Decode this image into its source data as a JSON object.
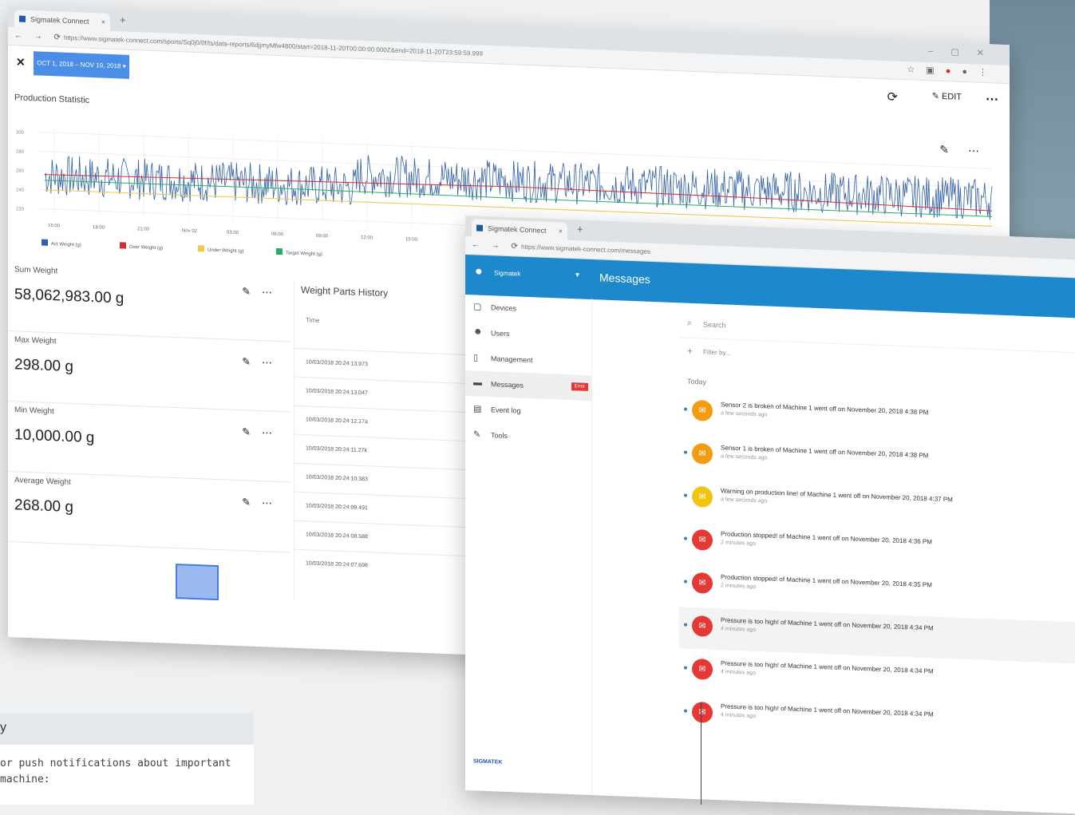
{
  "window1": {
    "tab_title": "Sigmatek Connect",
    "url": "https://www.sigmatek-connect.com/sports/Sq0j0/0f/ts/data-reports/6djjmyMfw4800/start=2018-11-20T00:00:00.000Z&end=2018-11-20T23:59:59.999",
    "date_range": "OCT 1, 2018 – NOV 19, 2018 ▾",
    "edit_label": "EDIT",
    "section_title": "Production Statistic",
    "stats": [
      {
        "label": "Sum Weight",
        "value": "58,062,983.00 g"
      },
      {
        "label": "Max Weight",
        "value": "298.00 g"
      },
      {
        "label": "Min Weight",
        "value": "10,000.00 g"
      },
      {
        "label": "Average Weight",
        "value": "268.00 g"
      }
    ],
    "history": {
      "title": "Weight Parts History",
      "header": "Time",
      "rows": [
        "10/03/2018 20:24:13.973",
        "10/03/2018 20:24:13.047",
        "10/03/2018 20:24:12.17a",
        "10/03/2018 20:24:11.27k",
        "10/03/2018 20:24:10.383",
        "10/03/2018 20:24:09.491",
        "10/03/2018 20:24:08.588",
        "10/03/2018 20:24:07.698"
      ]
    }
  },
  "chart_data": {
    "type": "line",
    "title": "",
    "x_ticks": [
      "15:00",
      "18:00",
      "21:00",
      "Nov 02",
      "03:00",
      "06:00",
      "09:00",
      "12:00",
      "15:00"
    ],
    "y_ticks": [
      "300",
      "280",
      "260",
      "240",
      "220"
    ],
    "ylim": [
      215,
      305
    ],
    "legend_position": "bottom-left",
    "series": [
      {
        "name": "Act Weight (g)",
        "color": "#2f5fa6",
        "style": "noisy",
        "mean_first_half": 255,
        "mean_second_half": 268,
        "amplitude": 22
      },
      {
        "name": "Over Weight (g)",
        "color": "#d32f2f",
        "style": "flat",
        "values": [
          256,
          259,
          262,
          260,
          256
        ]
      },
      {
        "name": "Under Weight (g)",
        "color": "#f2c94c",
        "style": "flat",
        "values": [
          240,
          240,
          240,
          240,
          240
        ]
      },
      {
        "name": "Target Weight (g)",
        "color": "#27ae60",
        "style": "flat",
        "values": [
          250,
          251,
          250,
          250,
          250
        ]
      }
    ]
  },
  "window2": {
    "tab_title": "Sigmatek Connect",
    "url": "https://www.sigmatek-connect.com/messages",
    "user_name": "Sigmatek",
    "page_title": "Messages",
    "sidebar": [
      {
        "label": "Devices",
        "icon": "▢"
      },
      {
        "label": "Users",
        "icon": "☻"
      },
      {
        "label": "Management",
        "icon": "▯"
      },
      {
        "label": "Messages",
        "icon": "▬",
        "badge": "Error",
        "active": true
      },
      {
        "label": "Event log",
        "icon": "▤"
      },
      {
        "label": "Tools",
        "icon": "✎"
      }
    ],
    "brand": "SIGMATEK",
    "search_placeholder": "Search",
    "filter_label": "Filter by...",
    "day_label": "Today",
    "messages": [
      {
        "text": "Sensor 2 is broken of Machine 1 went off on November 20, 2018 4:38 PM",
        "time": "a few seconds ago",
        "color": "#f39c12"
      },
      {
        "text": "Sensor 1 is broken of Machine 1 went off on November 20, 2018 4:38 PM",
        "time": "a few seconds ago",
        "color": "#f39c12"
      },
      {
        "text": "Warning on production line! of Machine 1 went off on November 20, 2018 4:37 PM",
        "time": "a few seconds ago",
        "color": "#f1c40f"
      },
      {
        "text": "Production stopped! of Machine 1 went off on November 20, 2018 4:36 PM",
        "time": "2 minutes ago",
        "color": "#e53935"
      },
      {
        "text": "Production stopped! of Machine 1 went off on November 20, 2018 4:35 PM",
        "time": "2 minutes ago",
        "color": "#e53935"
      },
      {
        "text": "Pressure is too high! of Machine 1 went off on November 20, 2018 4:34 PM",
        "time": "4 minutes ago",
        "color": "#e53935"
      },
      {
        "text": "Pressure is too high! of Machine 1 went off on November 20, 2018 4:34 PM",
        "time": "4 minutes ago",
        "color": "#e53935"
      },
      {
        "text": "Pressure is too high! of Machine 1 went off on November 20, 2018 4:34 PM",
        "time": "4 minutes ago",
        "color": "#e53935"
      }
    ]
  },
  "caption": {
    "heading": "y",
    "text": "or push notifications about important\nmachine:"
  }
}
